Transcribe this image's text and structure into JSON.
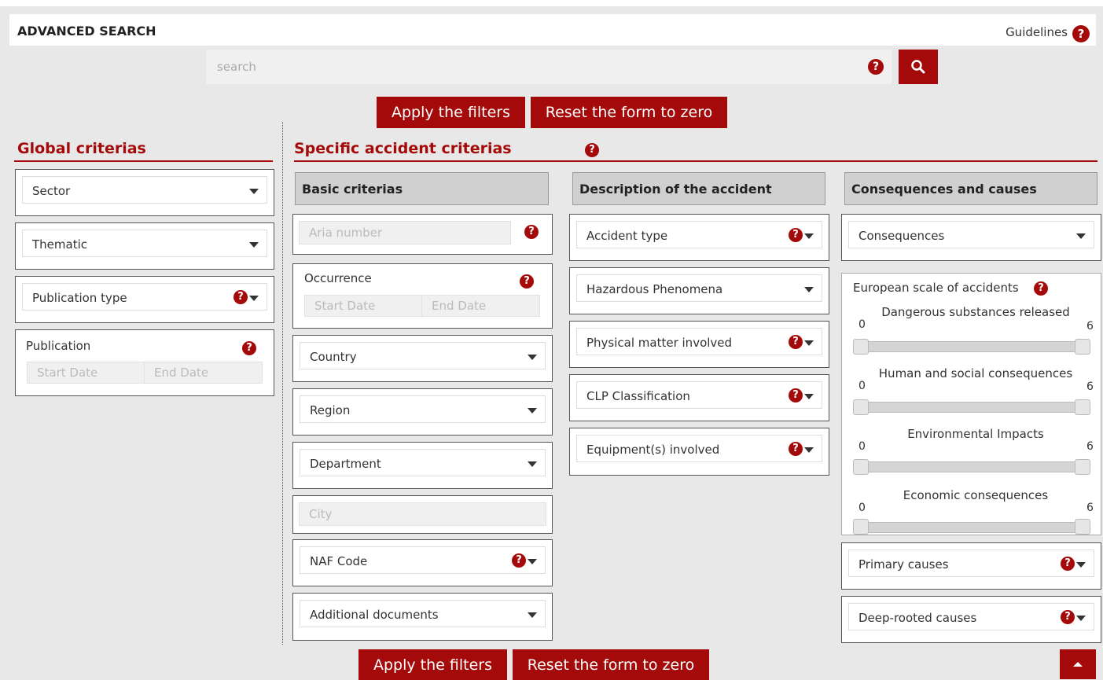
{
  "header": {
    "title": "ADVANCED SEARCH",
    "guidelines": "Guidelines",
    "help_glyph": "?"
  },
  "search": {
    "placeholder": "search"
  },
  "actions": {
    "apply": "Apply the filters",
    "reset": "Reset the form to zero"
  },
  "global": {
    "heading": "Global criterias",
    "sector": "Sector",
    "thematic": "Thematic",
    "publication_type": "Publication type",
    "publication": {
      "label": "Publication",
      "start": "Start Date",
      "end": "End Date"
    }
  },
  "specific": {
    "heading": "Specific accident criterias",
    "basic": {
      "heading": "Basic criterias",
      "aria_number": "Aria number",
      "occurrence": {
        "label": "Occurrence",
        "start": "Start Date",
        "end": "End Date"
      },
      "country": "Country",
      "region": "Region",
      "department": "Department",
      "city": "City",
      "naf_code": "NAF Code",
      "additional_documents": "Additional documents"
    },
    "description": {
      "heading": "Description of the accident",
      "accident_type": "Accident type",
      "hazardous_phenomena": "Hazardous Phenomena",
      "physical_matter": "Physical matter involved",
      "clp": "CLP Classification",
      "equipment": "Equipment(s) involved"
    },
    "consequences": {
      "heading": "Consequences and causes",
      "consequences": "Consequences",
      "scale_title": "European scale of accidents",
      "sliders": [
        {
          "label": "Dangerous substances released",
          "min": "0",
          "max": "6",
          "value_low": 0,
          "value_high": 6
        },
        {
          "label": "Human and social consequences",
          "min": "0",
          "max": "6",
          "value_low": 0,
          "value_high": 6
        },
        {
          "label": "Environmental Impacts",
          "min": "0",
          "max": "6",
          "value_low": 0,
          "value_high": 6
        },
        {
          "label": "Economic consequences",
          "min": "0",
          "max": "6",
          "value_low": 0,
          "value_high": 6
        }
      ],
      "primary_causes": "Primary causes",
      "deep_rooted_causes": "Deep-rooted causes"
    }
  },
  "colors": {
    "accent": "#a50a0a",
    "background": "#e8e8e8",
    "column_header": "#d0d0d0"
  }
}
